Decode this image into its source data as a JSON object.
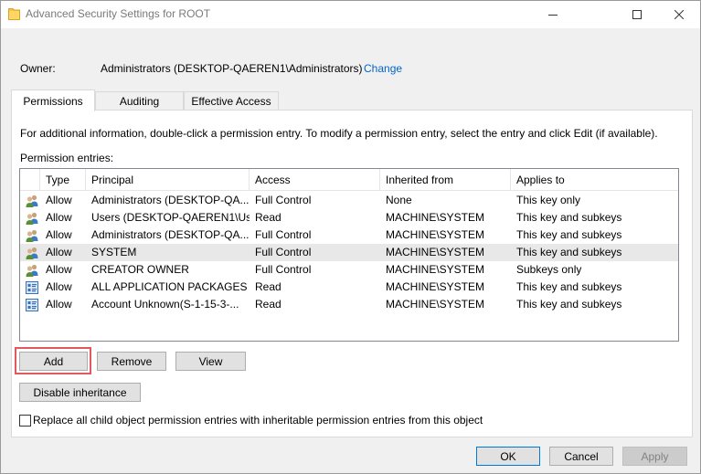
{
  "window": {
    "title": "Advanced Security Settings for ROOT",
    "folder_icon": "folder-icon"
  },
  "owner": {
    "label": "Owner:",
    "value": "Administrators (DESKTOP-QAEREN1\\Administrators)",
    "change_link": "Change"
  },
  "tabs": [
    {
      "label": "Permissions",
      "active": true
    },
    {
      "label": "Auditing",
      "active": false
    },
    {
      "label": "Effective Access",
      "active": false
    }
  ],
  "panel": {
    "info_text": "For additional information, double-click a permission entry. To modify a permission entry, select the entry and click Edit (if available).",
    "entries_label": "Permission entries:"
  },
  "table": {
    "columns": [
      "Type",
      "Principal",
      "Access",
      "Inherited from",
      "Applies to"
    ],
    "rows": [
      {
        "icon": "user-group-icon",
        "type": "Allow",
        "principal": "Administrators (DESKTOP-QA...",
        "access": "Full Control",
        "inherited": "None",
        "applies": "This key only",
        "selected": false
      },
      {
        "icon": "user-group-icon",
        "type": "Allow",
        "principal": "Users (DESKTOP-QAEREN1\\Us...",
        "access": "Read",
        "inherited": "MACHINE\\SYSTEM",
        "applies": "This key and subkeys",
        "selected": false
      },
      {
        "icon": "user-group-icon",
        "type": "Allow",
        "principal": "Administrators (DESKTOP-QA...",
        "access": "Full Control",
        "inherited": "MACHINE\\SYSTEM",
        "applies": "This key and subkeys",
        "selected": false
      },
      {
        "icon": "user-group-icon",
        "type": "Allow",
        "principal": "SYSTEM",
        "access": "Full Control",
        "inherited": "MACHINE\\SYSTEM",
        "applies": "This key and subkeys",
        "selected": true
      },
      {
        "icon": "user-group-icon",
        "type": "Allow",
        "principal": "CREATOR OWNER",
        "access": "Full Control",
        "inherited": "MACHINE\\SYSTEM",
        "applies": "Subkeys only",
        "selected": false
      },
      {
        "icon": "app-package-icon",
        "type": "Allow",
        "principal": "ALL APPLICATION PACKAGES",
        "access": "Read",
        "inherited": "MACHINE\\SYSTEM",
        "applies": "This key and subkeys",
        "selected": false
      },
      {
        "icon": "app-package-icon",
        "type": "Allow",
        "principal": "Account Unknown(S-1-15-3-...",
        "access": "Read",
        "inherited": "MACHINE\\SYSTEM",
        "applies": "This key and subkeys",
        "selected": false
      }
    ]
  },
  "buttons": {
    "add": "Add",
    "remove": "Remove",
    "view": "View",
    "disable_inheritance": "Disable inheritance",
    "ok": "OK",
    "cancel": "Cancel",
    "apply": "Apply"
  },
  "checkbox": {
    "label": "Replace all child object permission entries with inheritable permission entries from this object",
    "checked": false
  },
  "colors": {
    "link": "#0066cc",
    "highlight": "#e0595f",
    "default_button_border": "#0078d7"
  }
}
